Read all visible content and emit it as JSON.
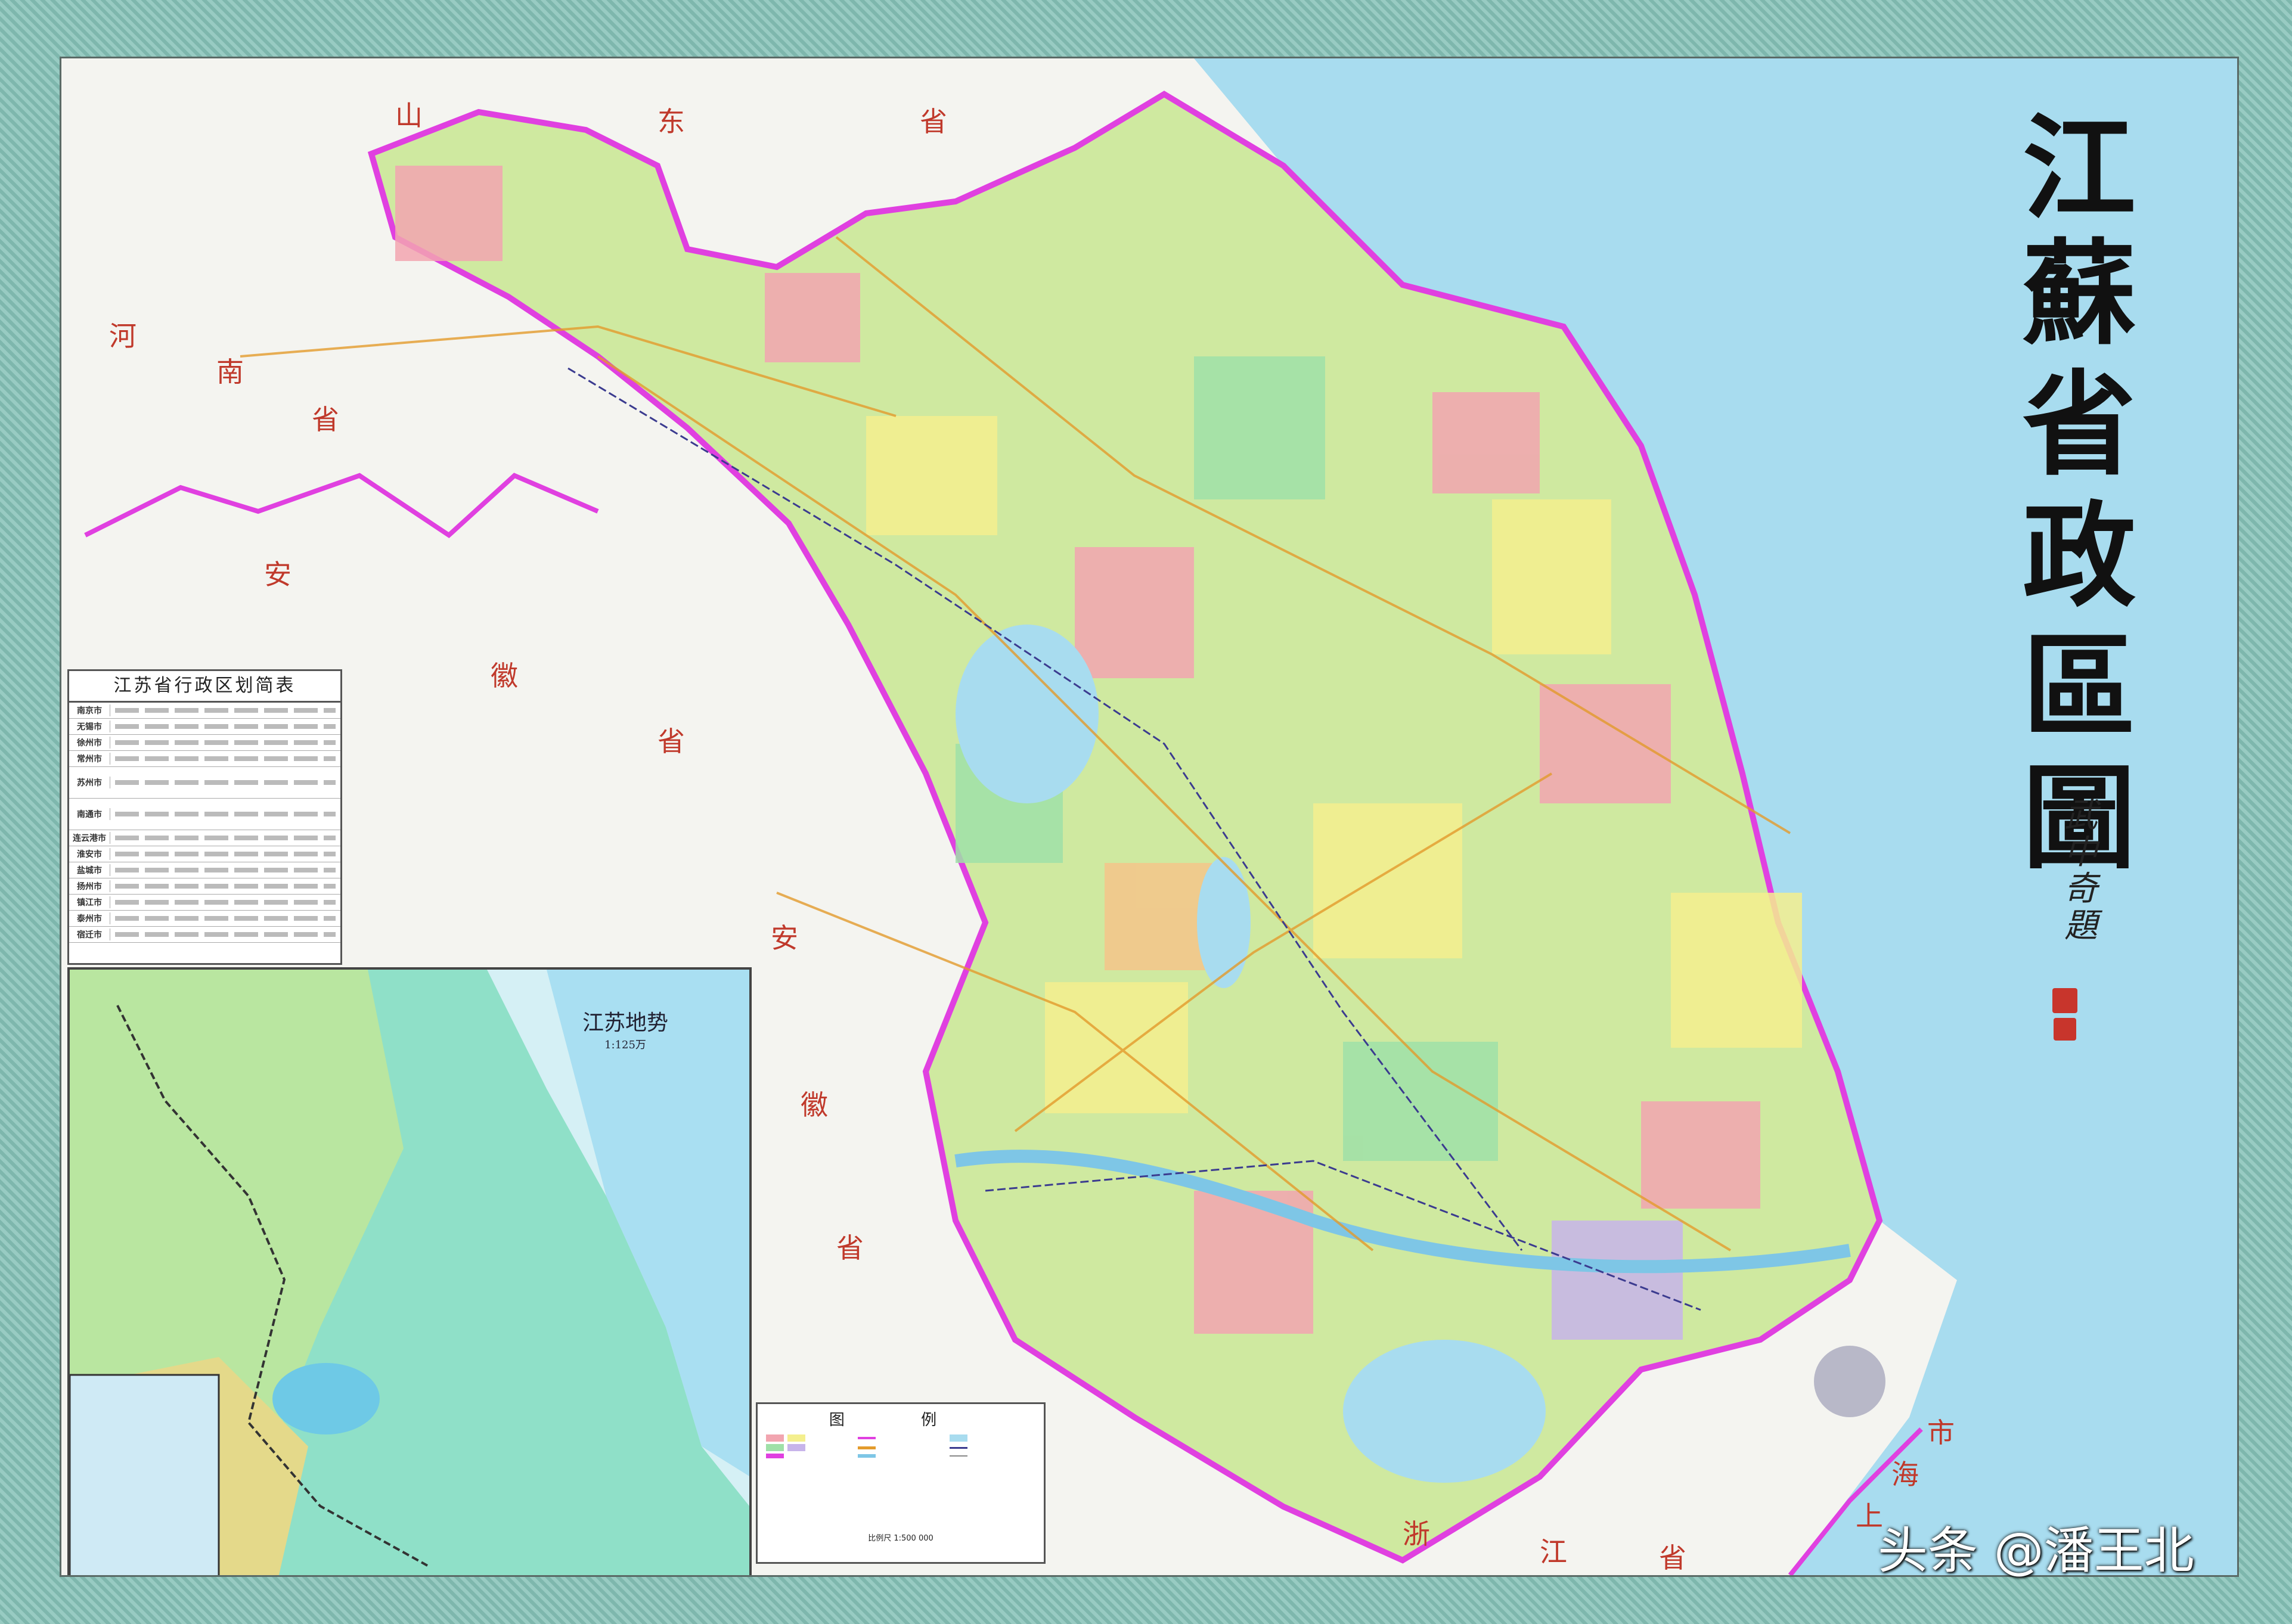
{
  "map": {
    "title_chars": [
      "江",
      "蘇",
      "省",
      "政",
      "區",
      "圖"
    ],
    "signature": "武中奇題",
    "neighbor_labels": [
      "山",
      "东",
      "省",
      "河",
      "南",
      "省",
      "安",
      "徽",
      "省",
      "安",
      "徽",
      "省",
      "浙",
      "江",
      "省",
      "上",
      "海",
      "市"
    ]
  },
  "admin_table": {
    "title": "江苏省行政区划简表",
    "cities": [
      "南京市",
      "无锡市",
      "徐州市",
      "常州市",
      "苏州市",
      "南通市",
      "连云港市",
      "淮安市",
      "盐城市",
      "扬州市",
      "镇江市",
      "泰州市",
      "宿迁市"
    ]
  },
  "terrain_inset": {
    "title": "江苏地势",
    "scale": "1:125万"
  },
  "legend": {
    "title": "图 例",
    "scale": "比例尺 1:500 000"
  },
  "footer": {
    "watermark": "头条 @潘王北"
  }
}
